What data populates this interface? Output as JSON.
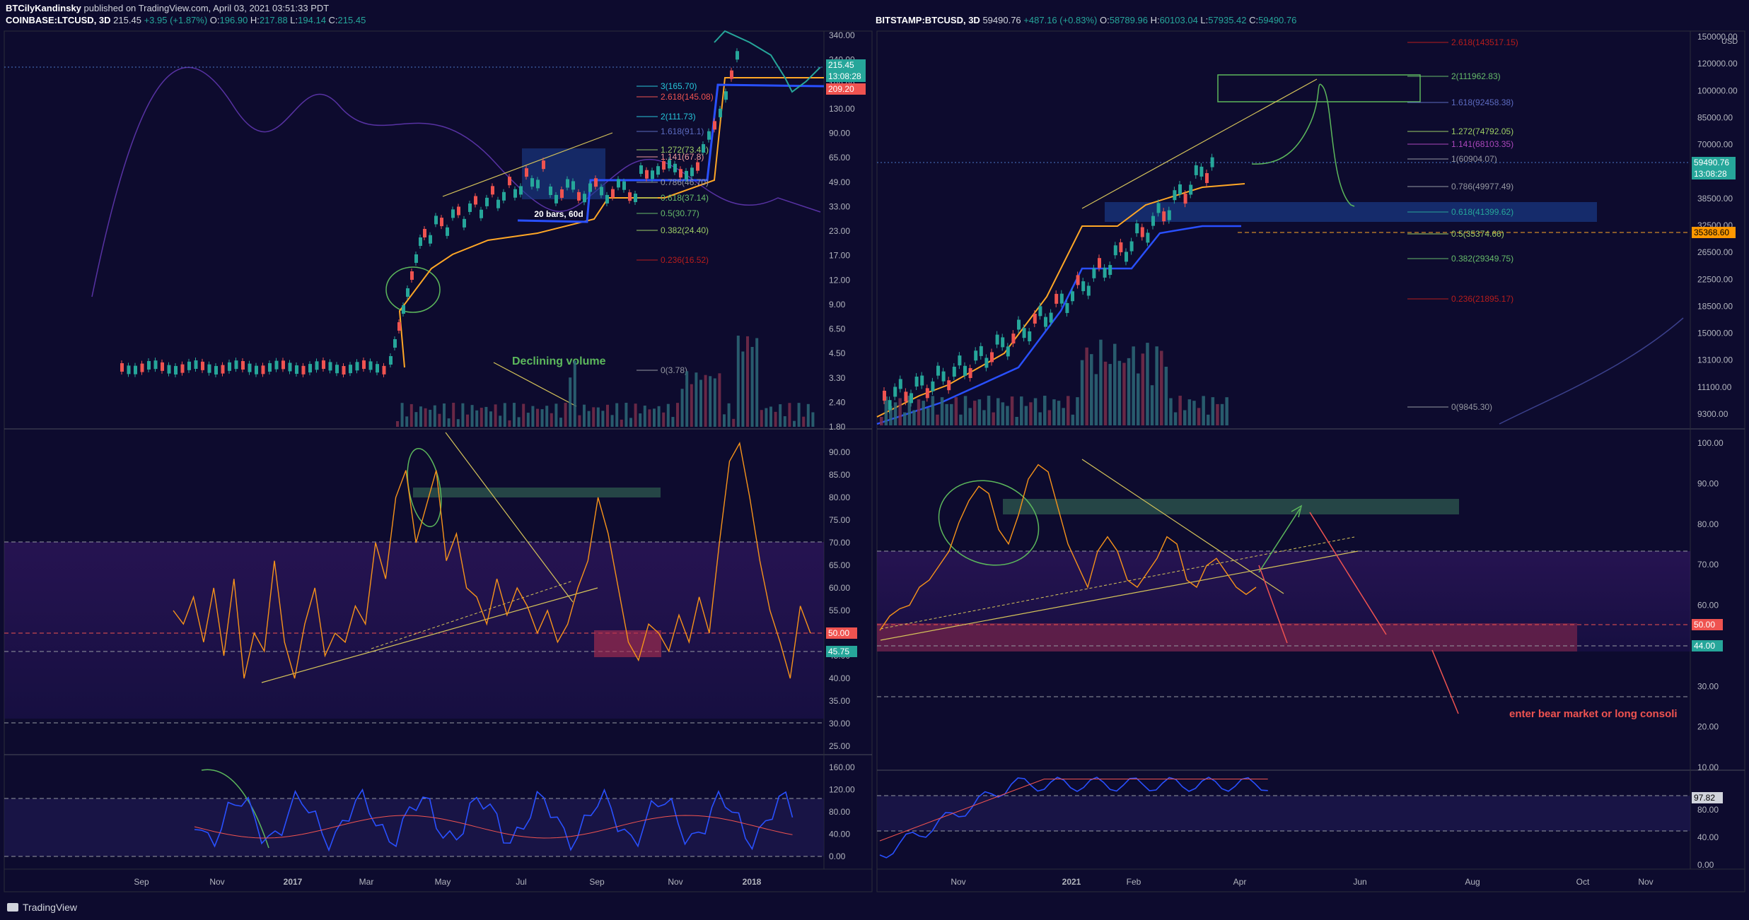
{
  "header": {
    "author": "BTCilyKandinsky",
    "published": "published on TradingView.com, April 03, 2021 03:51:33 PDT"
  },
  "left": {
    "symbol": "COINBASE:LTCUSD, 3D",
    "last": "215.45",
    "change": "+3.95 (+1.87%)",
    "o": "196.90",
    "h": "217.88",
    "l": "194.14",
    "c": "215.45",
    "price_label": "215.45",
    "countdown": "13:08:28",
    "level_label": "209.20",
    "price_axis": [
      "340.00",
      "240.00",
      "180.00",
      "130.00",
      "90.00",
      "65.00",
      "49.00",
      "33.00",
      "23.00",
      "17.00",
      "12.00",
      "9.00",
      "6.50",
      "4.50",
      "3.30",
      "2.40",
      "1.80"
    ],
    "rsi_axis": [
      "90.00",
      "85.00",
      "80.00",
      "75.00",
      "70.00",
      "65.00",
      "60.00",
      "55.00",
      "50.00",
      "45.00",
      "40.00",
      "35.00",
      "30.00",
      "25.00"
    ],
    "rsi_labels": [
      "50.00",
      "45.75"
    ],
    "mom_axis": [
      "160.00",
      "120.00",
      "80.00",
      "40.00",
      "0.00"
    ],
    "time_axis": [
      "Sep",
      "Nov",
      "2017",
      "Mar",
      "May",
      "Jul",
      "Sep",
      "Nov",
      "2018"
    ],
    "fib": [
      "3(165.70)",
      "2.618(145.08)",
      "2(111.73)",
      "1.618(91.1)",
      "1.272(73.42)",
      "1.141(67.8)",
      "0.786(46.70)",
      "0.618(37.14)",
      "0.5(30.77)",
      "0.382(24.40)",
      "0.236(16.52)",
      "0(3.78)"
    ],
    "annotations": {
      "volume_note": "Declining volume",
      "bars_note": "20 bars, 60d"
    }
  },
  "right": {
    "symbol": "BITSTAMP:BTCUSD, 3D",
    "last": "59490.76",
    "change": "+487.16 (+0.83%)",
    "o": "58789.96",
    "h": "60103.04",
    "l": "57935.42",
    "c": "59490.76",
    "currency": "USD",
    "price_label": "59490.76",
    "countdown": "13:08:28",
    "level_label": "35368.60",
    "price_axis": [
      "150000.00",
      "120000.00",
      "100000.00",
      "85000.00",
      "70000.00",
      "46000.00",
      "38500.00",
      "32500.00",
      "26500.00",
      "22500.00",
      "18500.00",
      "15000.00",
      "13100.00",
      "11100.00",
      "9300.00"
    ],
    "rsi_axis": [
      "100.00",
      "90.00",
      "80.00",
      "70.00",
      "60.00",
      "40.00",
      "30.00",
      "20.00",
      "10.00"
    ],
    "rsi_labels": [
      "50.00",
      "44.00"
    ],
    "mom_axis": [
      "80.00",
      "40.00",
      "0.00"
    ],
    "mom_label": "97.82",
    "time_axis": [
      "Nov",
      "2021",
      "Feb",
      "Apr",
      "Jun",
      "Aug",
      "Oct",
      "Nov"
    ],
    "fib": [
      "2.618(143517.15)",
      "2(111962.83)",
      "1.618(92458.38)",
      "1.272(74792.05)",
      "1.141(68103.35)",
      "1(60904.07)",
      "0.786(49977.49)",
      "0.618(41399.62)",
      "0.5(35374.66)",
      "0.382(29349.75)",
      "0.236(21895.17)",
      "0(9845.30)"
    ],
    "annotations": {
      "bear_note": "enter bear market or long consoli"
    }
  },
  "footer": {
    "brand": "TradingView"
  },
  "colors": {
    "bg": "#0d0b2e",
    "up": "#26a69a",
    "down": "#ef5350",
    "rsi": "#f7931a",
    "band": "#3a1a6e",
    "ma": "#ffa726"
  },
  "chart_data": [
    {
      "type": "line",
      "title": "COINBASE:LTCUSD, 3D",
      "x": [
        "Sep",
        "Nov",
        "2017",
        "Mar",
        "May",
        "Jul",
        "Sep",
        "Nov",
        "2018"
      ],
      "series": [
        {
          "values": [
            3.8,
            3.9,
            4.2,
            4.3,
            9.5,
            50,
            45,
            72,
            55,
            215
          ]
        }
      ],
      "ylim": [
        1.8,
        340
      ],
      "scale": "log"
    },
    {
      "type": "line",
      "title": "BITSTAMP:BTCUSD, 3D",
      "x": [
        "Nov",
        "2021",
        "Feb",
        "Apr",
        "Jun",
        "Aug",
        "Oct",
        "Nov"
      ],
      "series": [
        {
          "values": [
            13100,
            18500,
            29000,
            38500,
            33000,
            46000,
            57000,
            59490
          ]
        }
      ],
      "ylim": [
        9300,
        150000
      ],
      "scale": "log"
    }
  ]
}
